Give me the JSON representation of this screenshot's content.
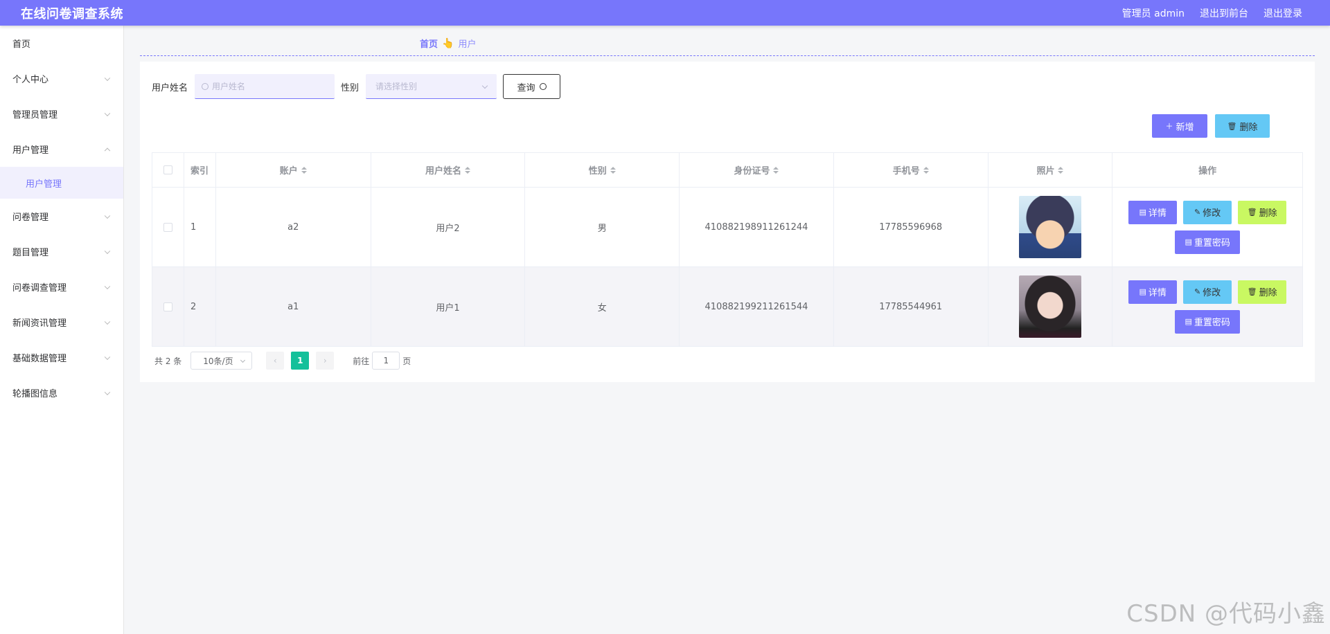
{
  "header": {
    "title": "在线问卷调查系统",
    "admin": "管理员 admin",
    "front": "退出到前台",
    "logout": "退出登录"
  },
  "sidebar": {
    "items": [
      {
        "label": "首页"
      },
      {
        "label": "个人中心"
      },
      {
        "label": "管理员管理"
      },
      {
        "label": "用户管理"
      },
      {
        "label": "问卷管理"
      },
      {
        "label": "题目管理"
      },
      {
        "label": "问卷调查管理"
      },
      {
        "label": "新闻资讯管理"
      },
      {
        "label": "基础数据管理"
      },
      {
        "label": "轮播图信息"
      }
    ],
    "active_sub": "用户管理"
  },
  "breadcrumb": {
    "home": "首页",
    "sep_icon": "👆",
    "current": "用户"
  },
  "search": {
    "name_label": "用户姓名",
    "name_placeholder": "用户姓名",
    "gender_label": "性别",
    "gender_placeholder": "请选择性别",
    "query_label": "查询"
  },
  "actions": {
    "add": "新增",
    "delete": "删除"
  },
  "table": {
    "headers": [
      "索引",
      "账户",
      "用户姓名",
      "性别",
      "身份证号",
      "手机号",
      "照片",
      "操作"
    ],
    "rows": [
      {
        "index": "1",
        "account": "a2",
        "name": "用户2",
        "gender": "男",
        "id_card": "410882198911261244",
        "phone": "17785596968"
      },
      {
        "index": "2",
        "account": "a1",
        "name": "用户1",
        "gender": "女",
        "id_card": "410882199211261544",
        "phone": "17785544961"
      }
    ],
    "ops": {
      "detail": "详情",
      "edit": "修改",
      "delete": "删除",
      "reset": "重置密码"
    }
  },
  "pagination": {
    "total": "共 2 条",
    "page_size": "10条/页",
    "current": "1",
    "goto_label": "前往",
    "goto_value": "1",
    "page_unit": "页"
  },
  "watermark": "CSDN @代码小鑫",
  "colors": {
    "primary": "#7776fb",
    "info": "#64c8f5",
    "warning": "#c9f862",
    "pager_active": "#14c09a"
  }
}
